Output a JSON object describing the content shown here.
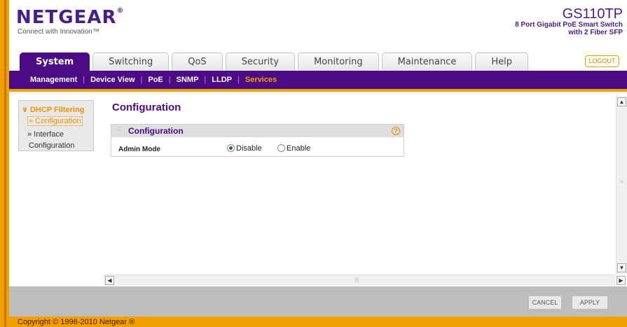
{
  "header": {
    "brand": "NETGEAR",
    "brand_mark": "®",
    "tagline": "Connect with Innovation™",
    "model": "GS110TP",
    "desc_line1": "8 Port Gigabit PoE Smart Switch",
    "desc_line2": "with 2 Fiber SFP",
    "logout": "LOGOUT"
  },
  "tabs": [
    "System",
    "Switching",
    "QoS",
    "Security",
    "Monitoring",
    "Maintenance",
    "Help"
  ],
  "active_tab": "System",
  "subnav": [
    "Management",
    "Device View",
    "PoE",
    "SNMP",
    "LLDP",
    "Services"
  ],
  "active_subnav": "Services",
  "sidemenu": {
    "group": "∨ DHCP Filtering",
    "item_configuration": "» Configuration",
    "item_interface_1": "» Interface",
    "item_interface_2": "Configuration"
  },
  "main": {
    "page_title": "Configuration",
    "panel_title": "Configuration",
    "help_symbol": "?",
    "admin_mode_label": "Admin Mode",
    "options": [
      "Disable",
      "Enable"
    ],
    "selected": "Disable"
  },
  "buttons": {
    "cancel": "CANCEL",
    "apply": "APPLY"
  },
  "footer": {
    "copyright": "Copyright © 1996-2010 Netgear ®"
  },
  "colors": {
    "brand_purple": "#4b0a86",
    "accent_orange": "#f0a000"
  }
}
